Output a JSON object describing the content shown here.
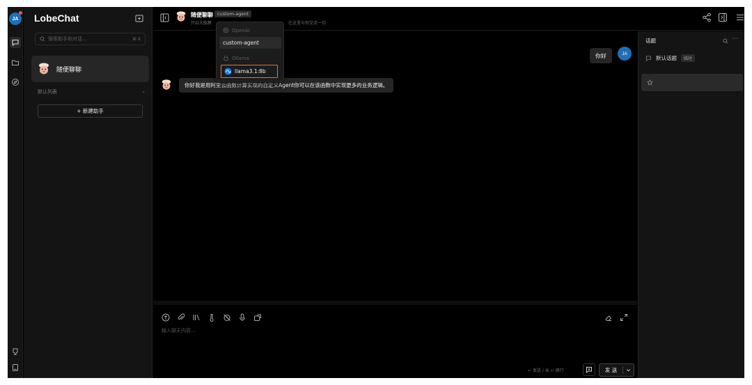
{
  "app": {
    "name": "LobeChat",
    "avatar_initials": "JA"
  },
  "sidebar": {
    "search_placeholder": "搜索助手和对话...",
    "search_shortcut": "⌘ K",
    "agents": [
      {
        "label": "随便聊聊"
      }
    ],
    "default_list_label": "默认列表",
    "new_agent_label": "+ 新建助手"
  },
  "header": {
    "title": "随便聊聊",
    "model_tag": "custom-agent",
    "description_start": "开启大脑集",
    "description_end": "在这里与你交流一切"
  },
  "model_dropdown": {
    "groups": [
      {
        "provider": "OpenAI",
        "items": [
          {
            "label": "custom-agent",
            "selected": true
          }
        ]
      },
      {
        "provider": "Ollama",
        "items": [
          {
            "label": "llama3.1:8b",
            "highlighted": true
          }
        ]
      }
    ]
  },
  "chat": {
    "messages": [
      {
        "role": "user",
        "text": "你好",
        "avatar": "JA"
      },
      {
        "role": "assistant",
        "text": "你好我是用阿里云函数计算实现的自定义Agent你可以在该函数中实现更多的业务逻辑。"
      }
    ]
  },
  "input": {
    "placeholder": "输入聊天内容...",
    "hint": "↵ 发送 / ⌘ ↵ 换行",
    "send_label": "发 送"
  },
  "topics": {
    "title": "话题",
    "items": [
      {
        "label": "默认话题",
        "badge": "临时"
      }
    ]
  },
  "colors": {
    "accent_orange": "#e8742a",
    "avatar_blue": "#1f6fb6",
    "notification_red": "#ff4d6a"
  }
}
